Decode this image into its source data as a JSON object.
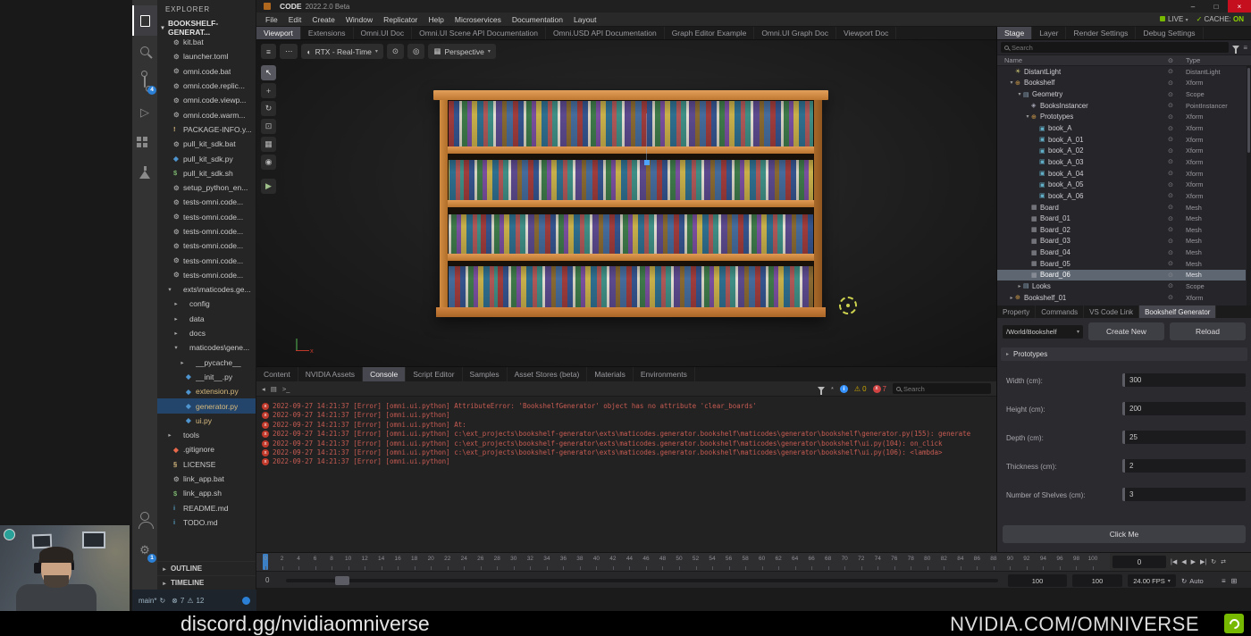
{
  "footer": {
    "left_text": "discord.gg/nvidiaomniverse",
    "right_text": "NVIDIA.COM/OMNIVERSE"
  },
  "vscode": {
    "explorer_title": "EXPLORER",
    "root_folder": "BOOKSHELF-GENERAT...",
    "activity_badges": {
      "source_control": "4",
      "settings": "1"
    },
    "files": [
      {
        "label": "kit.bat",
        "indent": 1,
        "kind": "file",
        "icon": "gear"
      },
      {
        "label": "launcher.toml",
        "indent": 1,
        "kind": "file",
        "icon": "gear"
      },
      {
        "label": "omni.code.bat",
        "indent": 1,
        "kind": "file",
        "icon": "gear"
      },
      {
        "label": "omni.code.replic...",
        "indent": 1,
        "kind": "file",
        "icon": "gear"
      },
      {
        "label": "omni.code.viewp...",
        "indent": 1,
        "kind": "file",
        "icon": "gear"
      },
      {
        "label": "omni.code.warm...",
        "indent": 1,
        "kind": "file",
        "icon": "gear"
      },
      {
        "label": "PACKAGE-INFO.y...",
        "indent": 1,
        "kind": "file",
        "icon": "warn"
      },
      {
        "label": "pull_kit_sdk.bat",
        "indent": 1,
        "kind": "file",
        "icon": "gear"
      },
      {
        "label": "pull_kit_sdk.py",
        "indent": 1,
        "kind": "file",
        "icon": "py"
      },
      {
        "label": "pull_kit_sdk.sh",
        "indent": 1,
        "kind": "file",
        "icon": "shell"
      },
      {
        "label": "setup_python_en...",
        "indent": 1,
        "kind": "file",
        "icon": "gear"
      },
      {
        "label": "tests-omni.code...",
        "indent": 1,
        "kind": "file",
        "icon": "gear"
      },
      {
        "label": "tests-omni.code...",
        "indent": 1,
        "kind": "file",
        "icon": "gear"
      },
      {
        "label": "tests-omni.code...",
        "indent": 1,
        "kind": "file",
        "icon": "gear"
      },
      {
        "label": "tests-omni.code...",
        "indent": 1,
        "kind": "file",
        "icon": "gear"
      },
      {
        "label": "tests-omni.code...",
        "indent": 1,
        "kind": "file",
        "icon": "gear"
      },
      {
        "label": "tests-omni.code...",
        "indent": 1,
        "kind": "file",
        "icon": "gear"
      },
      {
        "label": "exts\\maticodes.ge...",
        "indent": 1,
        "kind": "folder",
        "open": true
      },
      {
        "label": "config",
        "indent": 2,
        "kind": "folder",
        "open": false
      },
      {
        "label": "data",
        "indent": 2,
        "kind": "folder",
        "open": false
      },
      {
        "label": "docs",
        "indent": 2,
        "kind": "folder",
        "open": false
      },
      {
        "label": "maticodes\\gene...",
        "indent": 2,
        "kind": "folder",
        "open": true
      },
      {
        "label": "__pycache__",
        "indent": 3,
        "kind": "folder",
        "open": false
      },
      {
        "label": "__init__.py",
        "indent": 3,
        "kind": "file",
        "icon": "py"
      },
      {
        "label": "extension.py",
        "indent": 3,
        "kind": "file",
        "icon": "py",
        "modified": true
      },
      {
        "label": "generator.py",
        "indent": 3,
        "kind": "file",
        "icon": "py",
        "modified": true,
        "selected": true
      },
      {
        "label": "ui.py",
        "indent": 3,
        "kind": "file",
        "icon": "py",
        "modified": true
      },
      {
        "label": "tools",
        "indent": 1,
        "kind": "folder",
        "open": false
      },
      {
        "label": ".gitignore",
        "indent": 1,
        "kind": "file",
        "icon": "git"
      },
      {
        "label": "LICENSE",
        "indent": 1,
        "kind": "file",
        "icon": "license"
      },
      {
        "label": "link_app.bat",
        "indent": 1,
        "kind": "file",
        "icon": "gear"
      },
      {
        "label": "link_app.sh",
        "indent": 1,
        "kind": "file",
        "icon": "shell"
      },
      {
        "label": "README.md",
        "indent": 1,
        "kind": "file",
        "icon": "info"
      },
      {
        "label": "TODO.md",
        "indent": 1,
        "kind": "file",
        "icon": "info"
      }
    ],
    "sections": [
      "OUTLINE",
      "TIMELINE"
    ],
    "status": {
      "branch": "main*",
      "errors": "7",
      "warnings": "12"
    }
  },
  "omniverse": {
    "title": "CODE",
    "version": "2022.2.0 Beta",
    "window_controls": {
      "minimize": "–",
      "maximize": "□",
      "close": "×"
    },
    "live_label": "LIVE",
    "cache_label": "CACHE:",
    "cache_state": "ON",
    "menus": [
      "File",
      "Edit",
      "Create",
      "Window",
      "Replicator",
      "Help",
      "Microservices",
      "Documentation",
      "Layout"
    ],
    "doc_tabs": [
      {
        "label": "Viewport",
        "active": true
      },
      {
        "label": "Extensions"
      },
      {
        "label": "Omni.UI Doc"
      },
      {
        "label": "Omni.UI Scene API Documentation"
      },
      {
        "label": "Omni.USD API Documentation"
      },
      {
        "label": "Graph Editor Example"
      },
      {
        "label": "Omni.UI Graph Doc"
      },
      {
        "label": "Viewport Doc"
      }
    ],
    "viewport": {
      "renderer": "RTX - Real-Time",
      "camera": "Perspective",
      "tools": [
        {
          "name": "select-tool",
          "glyph": "↖"
        },
        {
          "name": "move-tool",
          "glyph": "+"
        },
        {
          "name": "rotate-tool",
          "glyph": "↻"
        },
        {
          "name": "scale-tool",
          "glyph": "⊡"
        },
        {
          "name": "snap-tool",
          "glyph": "▦"
        },
        {
          "name": "render-tool",
          "glyph": "◉"
        },
        {
          "name": "play-button",
          "glyph": "▶"
        }
      ]
    },
    "stage": {
      "tabs": [
        {
          "label": "Stage",
          "active": true
        },
        {
          "label": "Layer"
        },
        {
          "label": "Render Settings"
        },
        {
          "label": "Debug Settings"
        }
      ],
      "search_placeholder": "Search",
      "name_col": "Name",
      "type_col": "Type",
      "rows": [
        {
          "name": "DistantLight",
          "type": "DistantLight",
          "indent": 1,
          "icon": "light"
        },
        {
          "name": "Bookshelf",
          "type": "Xform",
          "indent": 1,
          "icon": "xform",
          "expand": "open"
        },
        {
          "name": "Geometry",
          "type": "Scope",
          "indent": 2,
          "icon": "scope",
          "expand": "open"
        },
        {
          "name": "BooksInstancer",
          "type": "PointInstancer",
          "indent": 3,
          "icon": "instancer"
        },
        {
          "name": "Prototypes",
          "type": "Xform",
          "indent": 3,
          "icon": "xform",
          "expand": "open"
        },
        {
          "name": "book_A",
          "type": "Xform",
          "indent": 4,
          "icon": "cube"
        },
        {
          "name": "book_A_01",
          "type": "Xform",
          "indent": 4,
          "icon": "cube"
        },
        {
          "name": "book_A_02",
          "type": "Xform",
          "indent": 4,
          "icon": "cube"
        },
        {
          "name": "book_A_03",
          "type": "Xform",
          "indent": 4,
          "icon": "cube"
        },
        {
          "name": "book_A_04",
          "type": "Xform",
          "indent": 4,
          "icon": "cube"
        },
        {
          "name": "book_A_05",
          "type": "Xform",
          "indent": 4,
          "icon": "cube"
        },
        {
          "name": "book_A_06",
          "type": "Xform",
          "indent": 4,
          "icon": "cube"
        },
        {
          "name": "Board",
          "type": "Mesh",
          "indent": 3,
          "icon": "mesh"
        },
        {
          "name": "Board_01",
          "type": "Mesh",
          "indent": 3,
          "icon": "mesh"
        },
        {
          "name": "Board_02",
          "type": "Mesh",
          "indent": 3,
          "icon": "mesh"
        },
        {
          "name": "Board_03",
          "type": "Mesh",
          "indent": 3,
          "icon": "mesh"
        },
        {
          "name": "Board_04",
          "type": "Mesh",
          "indent": 3,
          "icon": "mesh"
        },
        {
          "name": "Board_05",
          "type": "Mesh",
          "indent": 3,
          "icon": "mesh"
        },
        {
          "name": "Board_06",
          "type": "Mesh",
          "indent": 3,
          "icon": "mesh",
          "selected": true
        },
        {
          "name": "Looks",
          "type": "Scope",
          "indent": 2,
          "icon": "scope",
          "expand": "closed"
        },
        {
          "name": "Bookshelf_01",
          "type": "Xform",
          "indent": 1,
          "icon": "xform",
          "expand": "closed"
        }
      ]
    },
    "properties": {
      "tabs": [
        {
          "label": "Property"
        },
        {
          "label": "Commands"
        },
        {
          "label": "VS Code Link"
        },
        {
          "label": "Bookshelf Generator",
          "active": true
        }
      ],
      "path": "/World/Bookshelf",
      "create_label": "Create New",
      "reload_label": "Reload",
      "section_label": "Prototypes",
      "fields": [
        {
          "label": "Width (cm)",
          "value": "300"
        },
        {
          "label": "Height (cm)",
          "value": "200"
        },
        {
          "label": "Depth (cm)",
          "value": "25"
        },
        {
          "label": "Thickness (cm)",
          "value": "2"
        },
        {
          "label": "Number of Shelves (cm)",
          "value": "3"
        }
      ],
      "action_label": "Click Me"
    },
    "bottom_tabs": [
      {
        "label": "Content"
      },
      {
        "label": "NVIDIA Assets"
      },
      {
        "label": "Console",
        "active": true
      },
      {
        "label": "Script Editor"
      },
      {
        "label": "Samples"
      },
      {
        "label": "Asset Stores (beta)"
      },
      {
        "label": "Materials"
      },
      {
        "label": "Environments"
      }
    ],
    "console": {
      "search_placeholder": "Search",
      "warn_count": "0",
      "error_count": "7",
      "toolbar": [
        {
          "name": "back-icon",
          "glyph": "◂"
        },
        {
          "name": "folder-icon",
          "glyph": "▤"
        },
        {
          "name": "terminal-icon",
          "glyph": ">_"
        }
      ],
      "lines": [
        "2022-09-27 14:21:37  [Error] [omni.ui.python] AttributeError: 'BookshelfGenerator' object has no attribute 'clear_boards'",
        "2022-09-27 14:21:37  [Error] [omni.ui.python]",
        "2022-09-27 14:21:37  [Error] [omni.ui.python] At:",
        "2022-09-27 14:21:37  [Error] [omni.ui.python]   c:\\ext_projects\\bookshelf-generator\\exts\\maticodes.generator.bookshelf\\maticodes\\generator\\bookshelf\\generator.py(155): generate",
        "2022-09-27 14:21:37  [Error] [omni.ui.python]   c:\\ext_projects\\bookshelf-generator\\exts\\maticodes.generator.bookshelf\\maticodes\\generator\\bookshelf\\ui.py(104): on_click",
        "2022-09-27 14:21:37  [Error] [omni.ui.python]   c:\\ext_projects\\bookshelf-generator\\exts\\maticodes.generator.bookshelf\\maticodes\\generator\\bookshelf\\ui.py(106): <lambda>",
        "2022-09-27 14:21:37  [Error] [omni.ui.python]"
      ]
    },
    "timeline": {
      "start": 0,
      "end": 100,
      "step": 2,
      "current_frame": "0",
      "left_value": "0",
      "range_end_1": "100",
      "range_end_2": "100",
      "fps": "24.00 FPS",
      "auto_label": "Auto",
      "transport": [
        {
          "name": "skip-to-start",
          "glyph": "|◀"
        },
        {
          "name": "step-back",
          "glyph": "◀"
        },
        {
          "name": "play",
          "glyph": "▶"
        },
        {
          "name": "step-forward",
          "glyph": "▶|"
        },
        {
          "name": "loop",
          "glyph": "↻"
        },
        {
          "name": "ping-pong",
          "glyph": "⇄"
        }
      ]
    }
  }
}
